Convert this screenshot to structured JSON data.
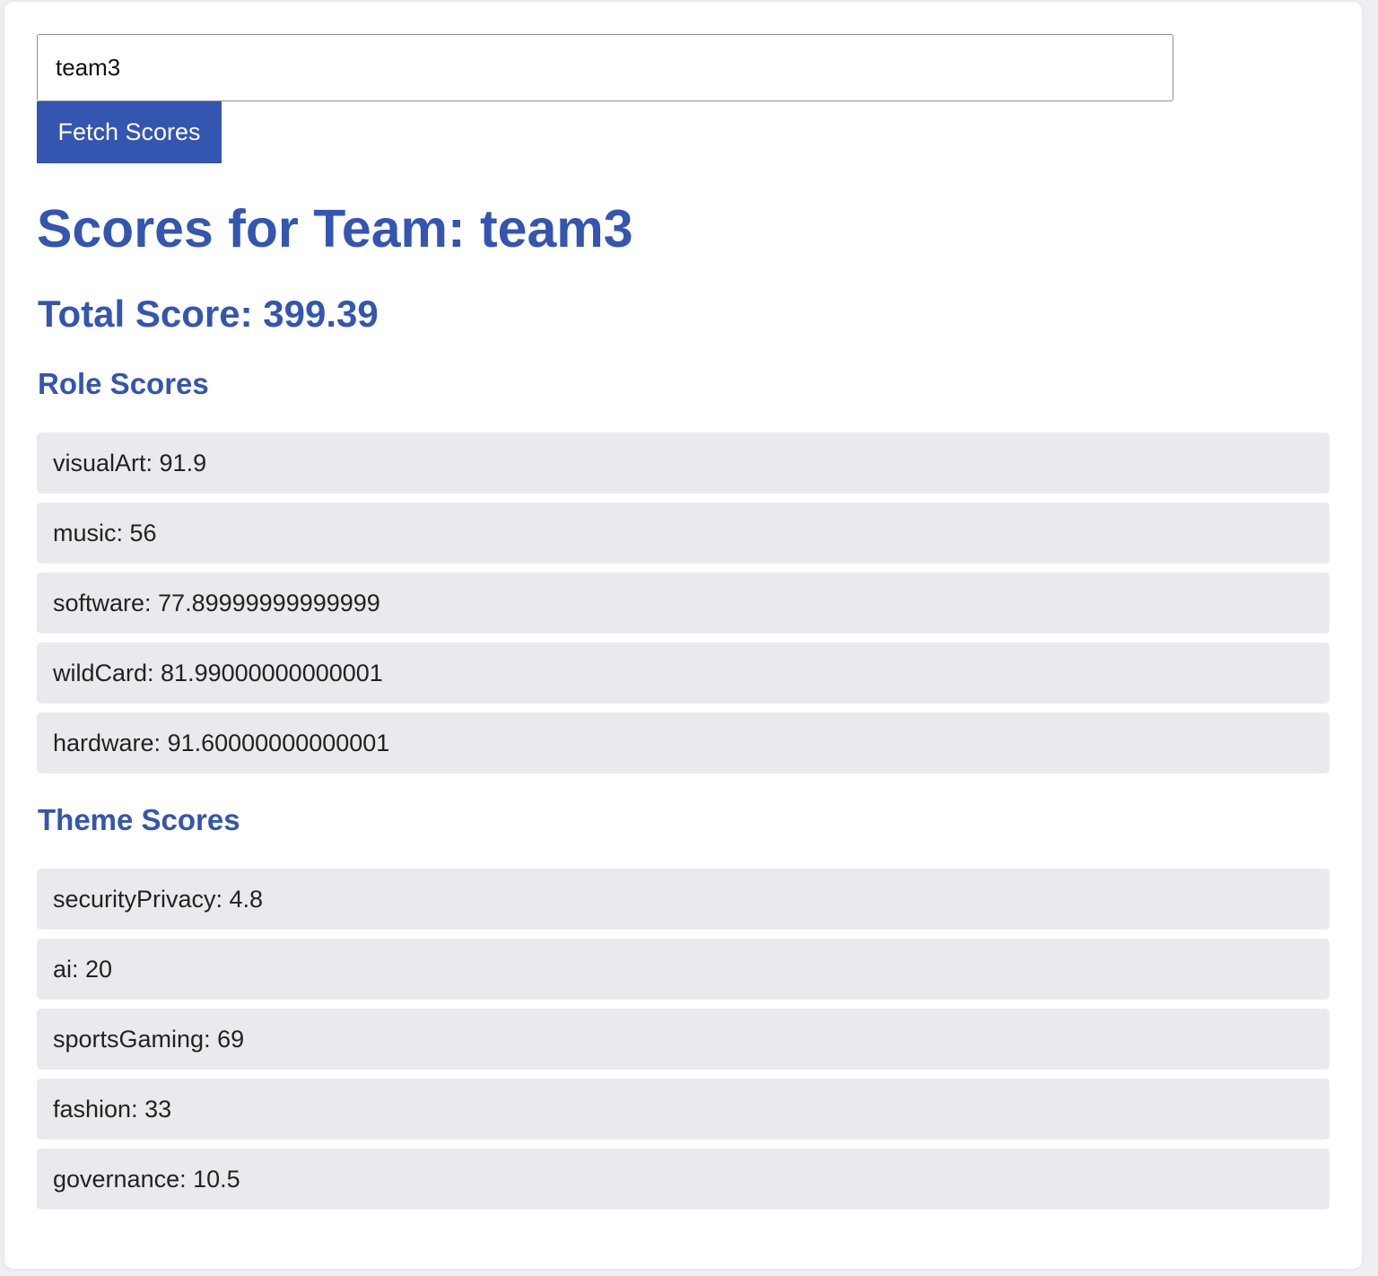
{
  "search": {
    "value": "team3",
    "button_label": "Fetch Scores"
  },
  "page_title": "Scores for Team: team3",
  "total_score": "Total Score: 399.39",
  "role_scores": {
    "heading": "Role Scores",
    "items": [
      "visualArt: 91.9",
      "music: 56",
      "software: 77.89999999999999",
      "wildCard: 81.99000000000001",
      "hardware: 91.60000000000001"
    ]
  },
  "theme_scores": {
    "heading": "Theme Scores",
    "items": [
      "securityPrivacy: 4.8",
      "ai: 20",
      "sportsGaming: 69",
      "fashion: 33",
      "governance: 10.5"
    ]
  },
  "colors": {
    "accent": "#3455b0",
    "item_background": "#e9eaed",
    "page_background": "#eeeff2"
  }
}
